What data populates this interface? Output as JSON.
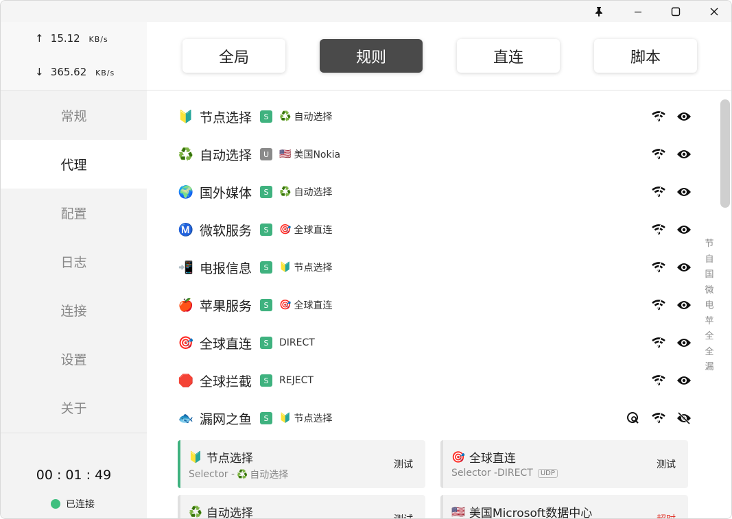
{
  "titlebar": {
    "icons": [
      "pin-icon",
      "minimize-icon",
      "maximize-icon",
      "close-icon"
    ]
  },
  "traffic": {
    "up_arrow": "↑",
    "up_value": "15.12",
    "up_unit": "KB/s",
    "down_arrow": "↓",
    "down_value": "365.62",
    "down_unit": "KB/s"
  },
  "nav": {
    "items": [
      "常规",
      "代理",
      "配置",
      "日志",
      "连接",
      "设置",
      "关于"
    ],
    "active_index": 1
  },
  "status": {
    "timer": "00 : 01 : 49",
    "connection": "已连接",
    "color": "#3fbf7f"
  },
  "modes": {
    "items": [
      "全局",
      "规则",
      "直连",
      "脚本"
    ],
    "active_index": 1
  },
  "groups": [
    {
      "emoji": "🔰",
      "name": "节点选择",
      "type": "S",
      "current_emoji": "♻️",
      "current": "自动选择"
    },
    {
      "emoji": "♻️",
      "name": "自动选择",
      "type": "U",
      "current_emoji": "🇺🇸",
      "current": "美国Nokia"
    },
    {
      "emoji": "🌍",
      "name": "国外媒体",
      "type": "S",
      "current_emoji": "♻️",
      "current": "自动选择"
    },
    {
      "emoji": "Ⓜ️",
      "name": "微软服务",
      "type": "S",
      "current_emoji": "🎯",
      "current": "全球直连"
    },
    {
      "emoji": "📲",
      "name": "电报信息",
      "type": "S",
      "current_emoji": "🔰",
      "current": "节点选择"
    },
    {
      "emoji": "🍎",
      "name": "苹果服务",
      "type": "S",
      "current_emoji": "🎯",
      "current": "全球直连"
    },
    {
      "emoji": "🎯",
      "name": "全球直连",
      "type": "S",
      "current_emoji": "",
      "current": "DIRECT"
    },
    {
      "emoji": "🛑",
      "name": "全球拦截",
      "type": "S",
      "current_emoji": "",
      "current": "REJECT"
    },
    {
      "emoji": "🐟",
      "name": "漏网之鱼",
      "type": "S",
      "current_emoji": "🔰",
      "current": "节点选择"
    }
  ],
  "index_chars": [
    "节",
    "自",
    "国",
    "微",
    "电",
    "苹",
    "全",
    "全",
    "漏"
  ],
  "cards": [
    {
      "emoji": "🔰",
      "title": "节点选择",
      "sub_prefix": "Selector - ",
      "sub_emoji": "♻️",
      "sub": "自动选择",
      "udp": "",
      "action": "测试",
      "selected": true
    },
    {
      "emoji": "🎯",
      "title": "全球直连",
      "sub_prefix": "Selector - ",
      "sub_emoji": "",
      "sub": "DIRECT",
      "udp": "UDP",
      "action": "测试",
      "selected": false
    },
    {
      "emoji": "♻️",
      "title": "自动选择",
      "sub_prefix": "",
      "sub_emoji": "",
      "sub": "",
      "udp": "",
      "action": "测试",
      "selected": false
    },
    {
      "emoji": "🇺🇸",
      "title": "美国Microsoft数据中心",
      "sub_prefix": "",
      "sub_emoji": "",
      "sub": "",
      "udp": "",
      "action": "超时",
      "selected": false
    }
  ],
  "colors": {
    "accent": "#3fb27f",
    "mode_active": "#4a4a4a",
    "timeout": "#e0342a"
  }
}
